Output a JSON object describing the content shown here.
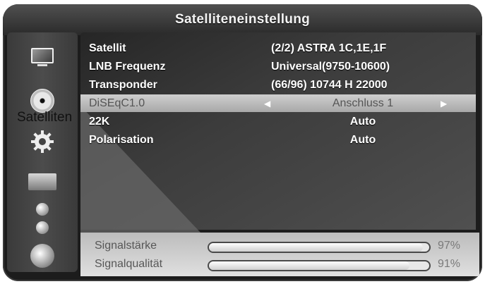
{
  "window": {
    "title": "Satelliteneinstellung"
  },
  "overlay": {
    "label": "Satelliten"
  },
  "sidebar": {
    "icons": [
      "tv-icon",
      "disc-icon",
      "gear-icon",
      "picture-icon",
      "dot-icon",
      "dot-icon",
      "globe-icon"
    ]
  },
  "settings": [
    {
      "label": "Satellit",
      "value": "(2/2) ASTRA 1C,1E,1F"
    },
    {
      "label": "LNB Frequenz",
      "value": "Universal(9750-10600)"
    },
    {
      "label": "Transponder",
      "value": "(66/96) 10744 H 22000"
    },
    {
      "label": "DiSEqC1.0",
      "value": "Anschluss 1",
      "selected": true
    },
    {
      "label": "22K",
      "value": "Auto"
    },
    {
      "label": "Polarisation",
      "value": "Auto"
    }
  ],
  "signal": {
    "strength": {
      "label": "Signalstärke",
      "value_text": "97%",
      "level": 97
    },
    "quality": {
      "label": "Signalqualität",
      "value_text": "91%",
      "level": 91
    }
  },
  "colors": {
    "background": "#1c1c1c",
    "selected_row": "#bdbdbd",
    "text": "#ffffff"
  }
}
